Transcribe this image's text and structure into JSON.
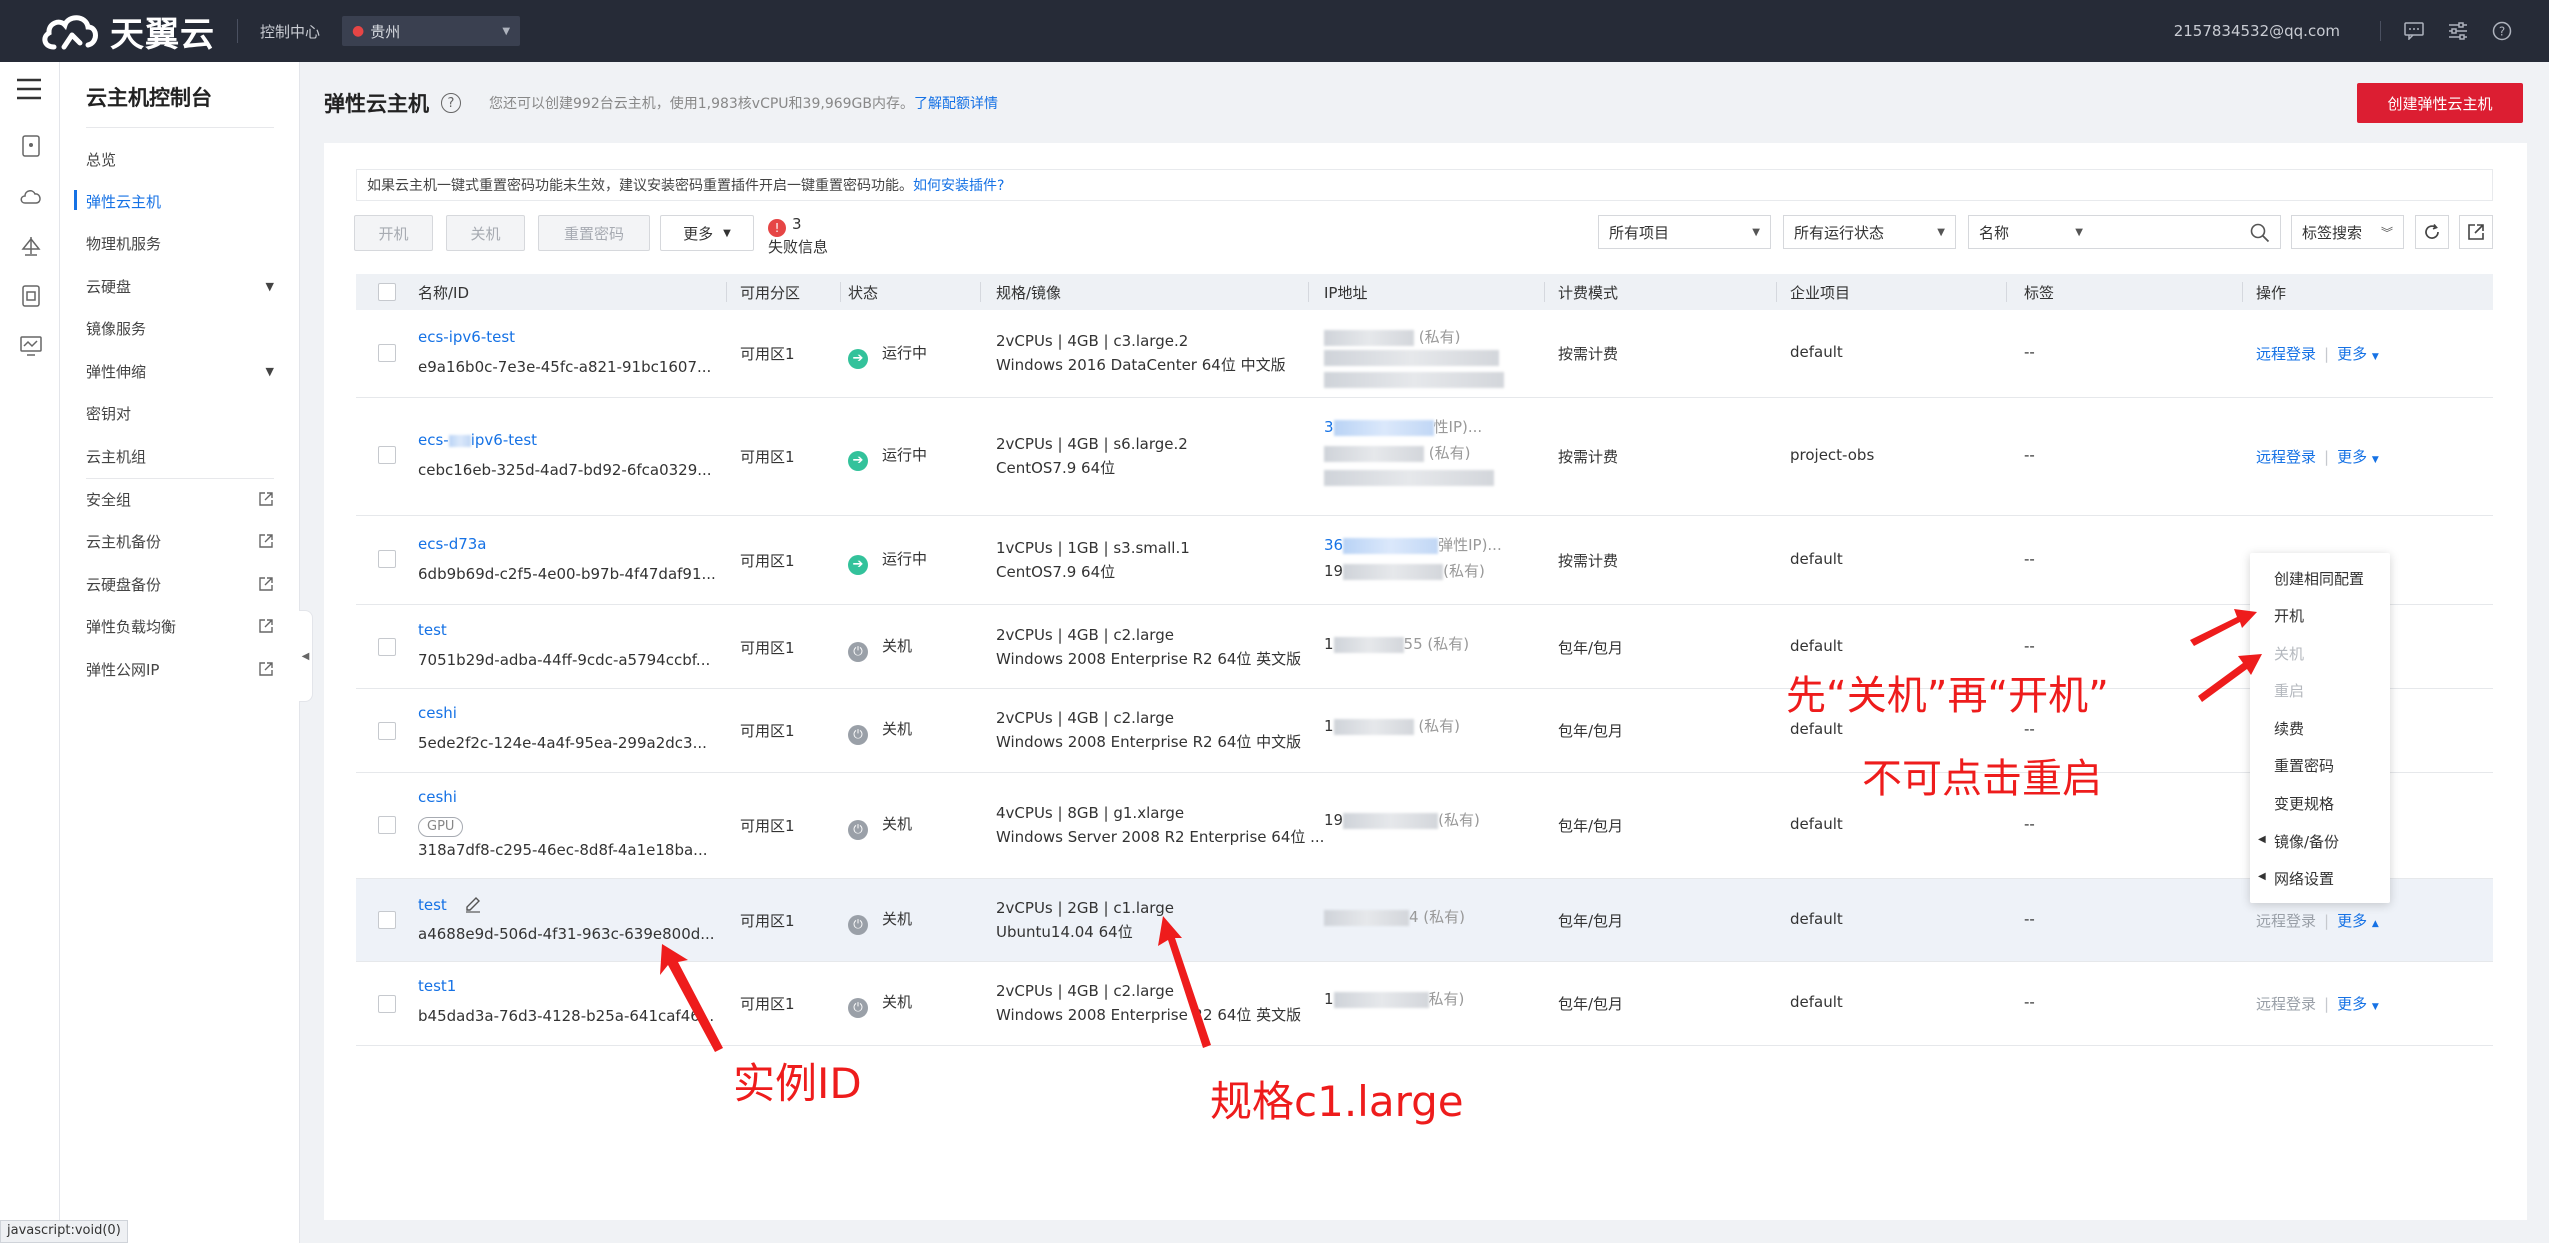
{
  "topbar": {
    "brand": "天翼云",
    "console": "控制中心",
    "region": "贵州",
    "user_email": "2157834532@qq.com",
    "icons": [
      "message-icon",
      "settings-icon",
      "help-icon"
    ]
  },
  "sidenav": {
    "title": "云主机控制台",
    "items": [
      {
        "label": "总览"
      },
      {
        "label": "弹性云主机",
        "active": true
      },
      {
        "label": "物理机服务"
      },
      {
        "label": "云硬盘",
        "expandable": true
      },
      {
        "label": "镜像服务"
      },
      {
        "label": "弹性伸缩",
        "expandable": true
      },
      {
        "label": "密钥对"
      },
      {
        "label": "云主机组"
      },
      {
        "label": "安全组",
        "external": true
      },
      {
        "label": "云主机备份",
        "external": true
      },
      {
        "label": "云硬盘备份",
        "external": true
      },
      {
        "label": "弹性负载均衡",
        "external": true
      },
      {
        "label": "弹性公网IP",
        "external": true
      }
    ]
  },
  "page": {
    "title": "弹性云主机",
    "quota_text": "您还可以创建992台云主机，使用1,983核vCPU和39,969GB内存。",
    "quota_link": "了解配额详情",
    "create_button": "创建弹性云主机",
    "notice_text": "如果云主机一键式重置密码功能未生效，建议安装密码重置插件开启一键重置密码功能。",
    "notice_link": "如何安装插件?"
  },
  "toolbar": {
    "start": "开机",
    "stop": "关机",
    "reset_password": "重置密码",
    "more": "更多",
    "fail_count": "3",
    "fail_label": "失败信息",
    "filter_project": "所有项目",
    "filter_status": "所有运行状态",
    "search_field": "名称",
    "tag_search": "标签搜索"
  },
  "table": {
    "headers": [
      "名称/ID",
      "可用分区",
      "状态",
      "规格/镜像",
      "IP地址",
      "计费模式",
      "企业项目",
      "标签",
      "操作"
    ],
    "rows": [
      {
        "name": "ecs-ipv6-test",
        "id": "e9a16b0c-7e3e-45fc-a821-91bc1607...",
        "zone": "可用区1",
        "status": "运行中",
        "spec": "2vCPUs | 4GB | c3.large.2",
        "image": "Windows 2016 DataCenter 64位 中文版",
        "ip1": "(私有)",
        "billing": "按需计费",
        "project": "default",
        "tag": "--",
        "op1": "远程登录",
        "op2": "更多"
      },
      {
        "name_prefix": "ecs-",
        "name_suffix": "ipv6-test",
        "id": "cebc16eb-325d-4ad7-bd92-6fca0329...",
        "zone": "可用区1",
        "status": "运行中",
        "spec": "2vCPUs | 4GB | s6.large.2",
        "image": "CentOS7.9 64位",
        "ip1": "3",
        "ip1_suffix": "性IP)...",
        "ip2": "(私有)",
        "billing": "按需计费",
        "project": "project-obs",
        "tag": "--",
        "op1": "远程登录",
        "op2": "更多"
      },
      {
        "name": "ecs-d73a",
        "id": "6db9b69d-c2f5-4e00-b97b-4f47daf91...",
        "zone": "可用区1",
        "status": "运行中",
        "spec": "1vCPUs | 1GB | s3.small.1",
        "image": "CentOS7.9 64位",
        "ip1": "36",
        "ip1_suffix": "弹性IP)...",
        "ip2": "19",
        "ip2_suffix": "(私有)",
        "billing": "按需计费",
        "project": "default",
        "tag": "--"
      },
      {
        "name": "test",
        "id": "7051b29d-adba-44ff-9cdc-a5794ccbf...",
        "zone": "可用区1",
        "status": "关机",
        "spec": "2vCPUs | 4GB | c2.large",
        "image": "Windows 2008 Enterprise R2 64位 英文版",
        "ip1": "1",
        "ip1_suffix": "55 (私有)",
        "billing": "包年/包月",
        "project": "default",
        "tag": "--"
      },
      {
        "name": "ceshi",
        "id": "5ede2f2c-124e-4a4f-95ea-299a2dc3...",
        "zone": "可用区1",
        "status": "关机",
        "spec": "2vCPUs | 4GB | c2.large",
        "image": "Windows 2008 Enterprise R2 64位 中文版",
        "ip1": "1",
        "ip1_suffix": "(私有)",
        "billing": "包年/包月",
        "project": "default",
        "tag": "--"
      },
      {
        "name": "ceshi",
        "gpu": "GPU",
        "id": "318a7df8-c295-46ec-8d8f-4a1e18ba...",
        "zone": "可用区1",
        "status": "关机",
        "spec": "4vCPUs | 8GB | g1.xlarge",
        "image": "Windows Server 2008 R2 Enterprise 64位 ...",
        "ip1": "19",
        "ip1_suffix": "(私有)",
        "billing": "包年/包月",
        "project": "default",
        "tag": "--"
      },
      {
        "name": "test",
        "id": "a4688e9d-506d-4f31-963c-639e800d...",
        "zone": "可用区1",
        "status": "关机",
        "spec": "2vCPUs | 2GB | c1.large",
        "image": "Ubuntu14.04 64位",
        "ip1": "4 (私有)",
        "billing": "包年/包月",
        "project": "default",
        "tag": "--",
        "op1": "远程登录",
        "op2": "更多"
      },
      {
        "name": "test1",
        "id": "b45dad3a-76d3-4128-b25a-641caf46...",
        "zone": "可用区1",
        "status": "关机",
        "spec": "2vCPUs | 4GB | c2.large",
        "image": "Windows 2008 Enterprise R2 64位 英文版",
        "ip1": "1",
        "ip1_suffix": "私有)",
        "billing": "包年/包月",
        "project": "default",
        "tag": "--",
        "op1": "远程登录",
        "op2": "更多"
      }
    ]
  },
  "dropdown": {
    "items": [
      {
        "label": "创建相同配置",
        "disabled": false
      },
      {
        "label": "开机",
        "disabled": false
      },
      {
        "label": "关机",
        "disabled": true
      },
      {
        "label": "重启",
        "disabled": true
      },
      {
        "label": "续费",
        "disabled": false
      },
      {
        "label": "重置密码",
        "disabled": false
      },
      {
        "label": "变更规格",
        "disabled": false
      },
      {
        "label": "镜像/备份",
        "disabled": false,
        "submenu": true
      },
      {
        "label": "网络设置",
        "disabled": false,
        "submenu": true
      }
    ]
  },
  "annotations": {
    "instance_id": "实例ID",
    "spec": "规格c1.large",
    "shutdown_then_start": "先“关机”再“开机”",
    "no_restart": "不可点击重启",
    "color": "#ee1c1c"
  },
  "status_bar": "javascript:void(0)"
}
